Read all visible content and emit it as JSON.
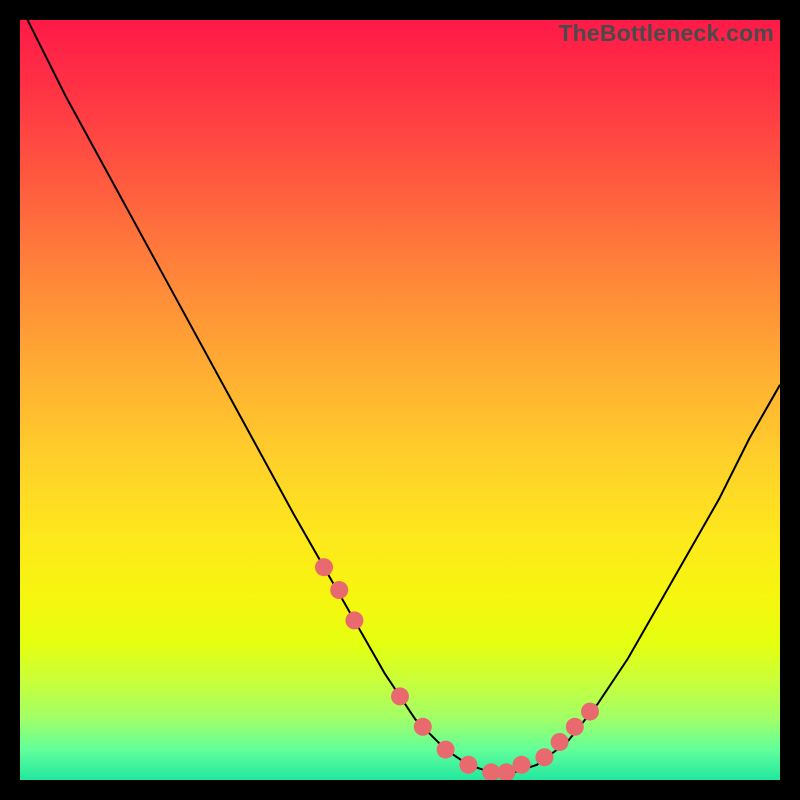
{
  "watermark": "TheBottleneck.com",
  "colors": {
    "dot": "#e86a6f",
    "line": "#000000"
  },
  "chart_data": {
    "type": "line",
    "title": "",
    "xlabel": "",
    "ylabel": "",
    "xlim": [
      0,
      100
    ],
    "ylim": [
      0,
      100
    ],
    "grid": false,
    "series": [
      {
        "name": "bottleneck-curve",
        "x": [
          1,
          6,
          12,
          18,
          24,
          30,
          36,
          40,
          44,
          48,
          52,
          56,
          59,
          62,
          65,
          68,
          72,
          76,
          80,
          84,
          88,
          92,
          96,
          100
        ],
        "y": [
          100,
          90,
          79,
          68,
          57,
          46,
          35,
          28,
          21,
          14,
          8,
          4,
          2,
          1,
          1,
          2,
          5,
          10,
          16,
          23,
          30,
          37,
          45,
          52
        ]
      }
    ],
    "markers": {
      "name": "highlight-dots",
      "x": [
        40,
        42,
        44,
        50,
        53,
        56,
        59,
        62,
        64,
        66,
        69,
        71,
        73,
        75
      ],
      "y": [
        28,
        25,
        21,
        11,
        7,
        4,
        2,
        1,
        1,
        2,
        3,
        5,
        7,
        9
      ]
    }
  }
}
